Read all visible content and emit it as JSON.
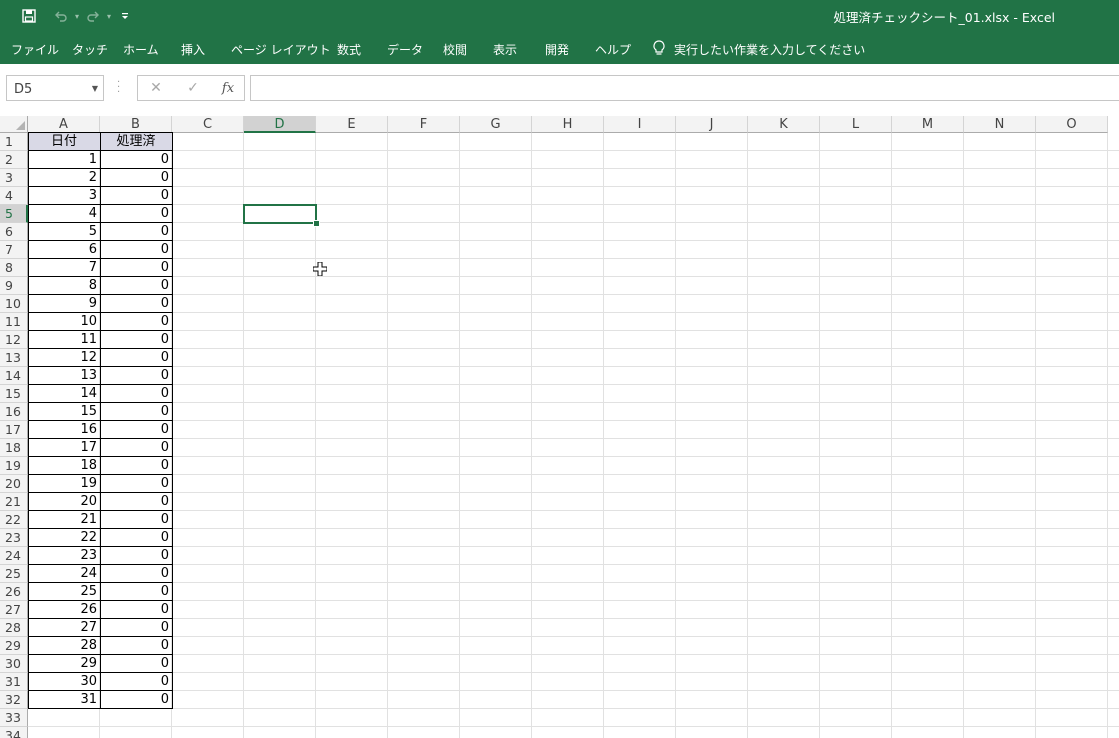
{
  "title_bar": {
    "window_title": "処理済チェックシート_01.xlsx  -  Excel"
  },
  "ribbon": {
    "tabs": [
      "ファイル",
      "タッチ",
      "ホーム",
      "挿入",
      "ページ レイアウト",
      "数式",
      "データ",
      "校閲",
      "表示",
      "開発",
      "ヘルプ"
    ],
    "tell_me": "実行したい作業を入力してください"
  },
  "formula_bar": {
    "name_box": "D5",
    "fx": "fx",
    "formula": ""
  },
  "sheet": {
    "columns": [
      "A",
      "B",
      "C",
      "D",
      "E",
      "F",
      "G",
      "H",
      "I",
      "J",
      "K",
      "L",
      "M",
      "N",
      "O"
    ],
    "rows": [
      "1",
      "2",
      "3",
      "4",
      "5",
      "6",
      "7",
      "8",
      "9",
      "10",
      "11",
      "12",
      "13",
      "14",
      "15",
      "16",
      "17",
      "18",
      "19",
      "20",
      "21",
      "22",
      "23",
      "24",
      "25",
      "26",
      "27",
      "28",
      "29",
      "30",
      "31",
      "32",
      "33",
      "34"
    ],
    "selected_column": "D",
    "selected_row": "5",
    "header_row": {
      "A": "日付",
      "B": "処理済"
    },
    "data": [
      [
        "1",
        "0"
      ],
      [
        "2",
        "0"
      ],
      [
        "3",
        "0"
      ],
      [
        "4",
        "0"
      ],
      [
        "5",
        "0"
      ],
      [
        "6",
        "0"
      ],
      [
        "7",
        "0"
      ],
      [
        "8",
        "0"
      ],
      [
        "9",
        "0"
      ],
      [
        "10",
        "0"
      ],
      [
        "11",
        "0"
      ],
      [
        "12",
        "0"
      ],
      [
        "13",
        "0"
      ],
      [
        "14",
        "0"
      ],
      [
        "15",
        "0"
      ],
      [
        "16",
        "0"
      ],
      [
        "17",
        "0"
      ],
      [
        "18",
        "0"
      ],
      [
        "19",
        "0"
      ],
      [
        "20",
        "0"
      ],
      [
        "21",
        "0"
      ],
      [
        "22",
        "0"
      ],
      [
        "23",
        "0"
      ],
      [
        "24",
        "0"
      ],
      [
        "25",
        "0"
      ],
      [
        "26",
        "0"
      ],
      [
        "27",
        "0"
      ],
      [
        "28",
        "0"
      ],
      [
        "29",
        "0"
      ],
      [
        "30",
        "0"
      ],
      [
        "31",
        "0"
      ]
    ]
  },
  "colors": {
    "brand": "#217346",
    "header_fill": "#d9d9e6"
  }
}
